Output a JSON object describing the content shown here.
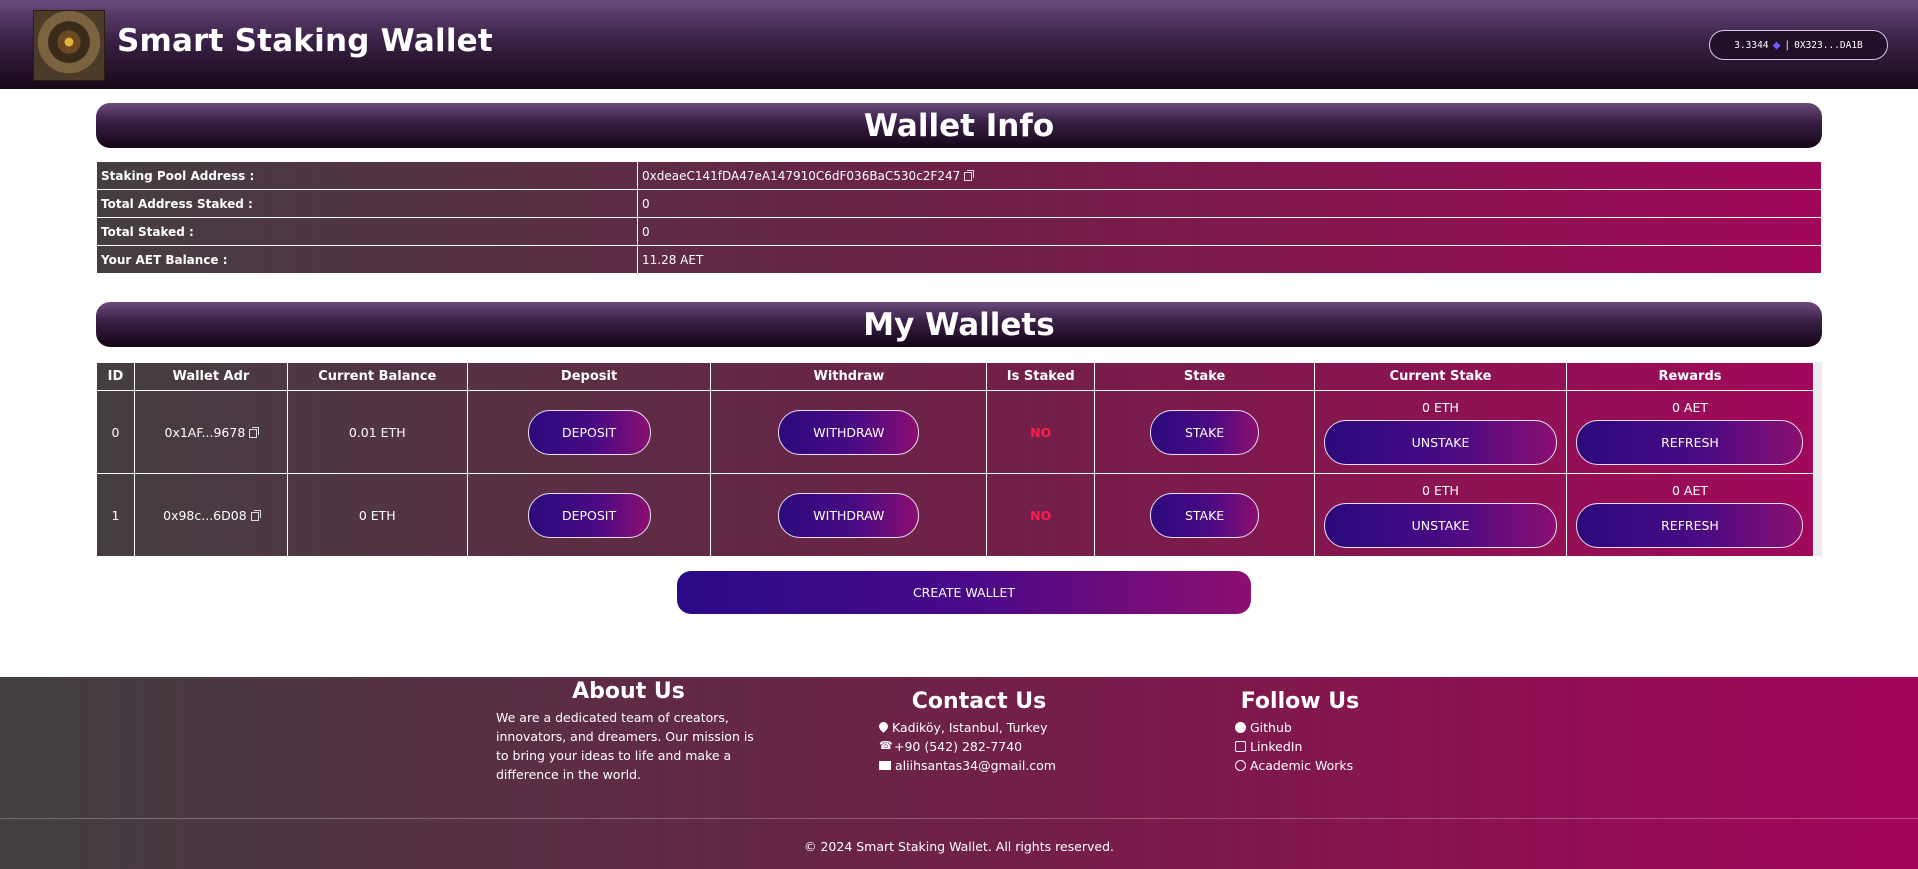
{
  "header": {
    "title": "Smart Staking Wallet",
    "account": {
      "balance": "3.3344",
      "separator": "|",
      "address": "0X323...DA1B"
    }
  },
  "wallet_info": {
    "title": "Wallet Info",
    "rows": [
      {
        "label": "Staking Pool Address :",
        "value": "0xdeaeC141fDA47eA147910C6dF036BaC530c2F247"
      },
      {
        "label": "Total Address Staked :",
        "value": "0"
      },
      {
        "label": "Total Staked :",
        "value": "0"
      },
      {
        "label": "Your AET Balance :",
        "value": "11.28 AET"
      }
    ]
  },
  "my_wallets": {
    "title": "My Wallets",
    "columns": [
      "ID",
      "Wallet Adr",
      "Current Balance",
      "Deposit",
      "Withdraw",
      "Is Staked",
      "Stake",
      "Current Stake",
      "Rewards"
    ],
    "rows": [
      {
        "id": "0",
        "address": "0x1AF...9678",
        "balance": "0.01 ETH",
        "deposit": "DEPOSIT",
        "withdraw": "WITHDRAW",
        "is_staked": "NO",
        "stake": "STAKE",
        "current_stake": "0 ETH",
        "unstake": "UNSTAKE",
        "rewards": "0 AET",
        "refresh": "REFRESH"
      },
      {
        "id": "1",
        "address": "0x98c...6D08",
        "balance": "0 ETH",
        "deposit": "DEPOSIT",
        "withdraw": "WITHDRAW",
        "is_staked": "NO",
        "stake": "STAKE",
        "current_stake": "0 ETH",
        "unstake": "UNSTAKE",
        "rewards": "0 AET",
        "refresh": "REFRESH"
      }
    ],
    "create_label": "CREATE WALLET"
  },
  "footer": {
    "about": {
      "title": "About Us",
      "text": "We are a dedicated team of creators, innovators, and dreamers. Our mission is to bring your ideas to life and make a difference in the world."
    },
    "contact": {
      "title": "Contact Us",
      "location": "Kadiköy, Istanbul, Turkey",
      "phone": "+90 (542) 282-7740",
      "email": "aliihsantas34@gmail.com"
    },
    "follow": {
      "title": "Follow Us",
      "github": "Github",
      "linkedin": "LinkedIn",
      "academic": "Academic Works"
    },
    "copyright": "© 2024 Smart Staking Wallet. All rights reserved."
  },
  "colors": {
    "header_dark": "#170818",
    "table_left": "#443e42",
    "table_right": "#a1085a",
    "button_start": "#2b0a7c",
    "button_end": "#8a0f70",
    "no_red": "#ff1e4b"
  }
}
